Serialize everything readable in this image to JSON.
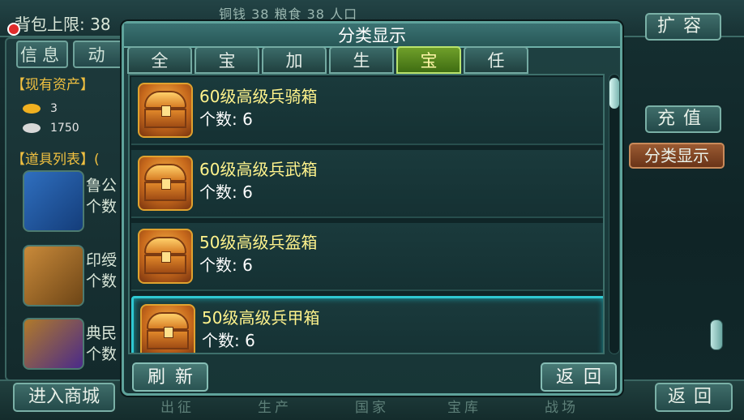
{
  "background": {
    "capacity_label": "背包上限: 38",
    "stats_text": "铜钱 38   粮食 38   人口",
    "tabs": [
      "信息",
      "动"
    ],
    "assets_header": "【现有资产】",
    "gold_amount": "3",
    "silver_amount": "1750",
    "items_header": "【道具列表】(",
    "items": [
      {
        "name": "鲁公",
        "count": "个数"
      },
      {
        "name": "印绶",
        "count": "个数"
      },
      {
        "name": "典民",
        "count": "个数"
      }
    ],
    "right_buttons": {
      "expand": "扩容",
      "recharge": "充值",
      "category": "分类显示"
    },
    "bottom": {
      "enter_shop": "进入商城",
      "back": "返回",
      "nav": [
        "出征",
        "生产",
        "国家",
        "宝库",
        "战场"
      ]
    }
  },
  "modal": {
    "title": "分类显示",
    "tabs": [
      {
        "label": "全部",
        "active": false
      },
      {
        "label": "宝物",
        "active": false
      },
      {
        "label": "加速",
        "active": false
      },
      {
        "label": "生产",
        "active": false
      },
      {
        "label": "宝箱",
        "active": true
      },
      {
        "label": "任务",
        "active": false
      }
    ],
    "items": [
      {
        "name": "60级高级兵骑箱",
        "count": "个数: 6",
        "icon": "treasure-chest-icon",
        "selected": false
      },
      {
        "name": "60级高级兵武箱",
        "count": "个数: 6",
        "icon": "treasure-chest-icon",
        "selected": false
      },
      {
        "name": "50级高级兵盔箱",
        "count": "个数: 6",
        "icon": "treasure-chest-icon",
        "selected": false
      },
      {
        "name": "50级高级兵甲箱",
        "count": "个数: 6",
        "icon": "treasure-chest-icon",
        "selected": true
      }
    ],
    "refresh_label": "刷新",
    "back_label": "返回"
  }
}
